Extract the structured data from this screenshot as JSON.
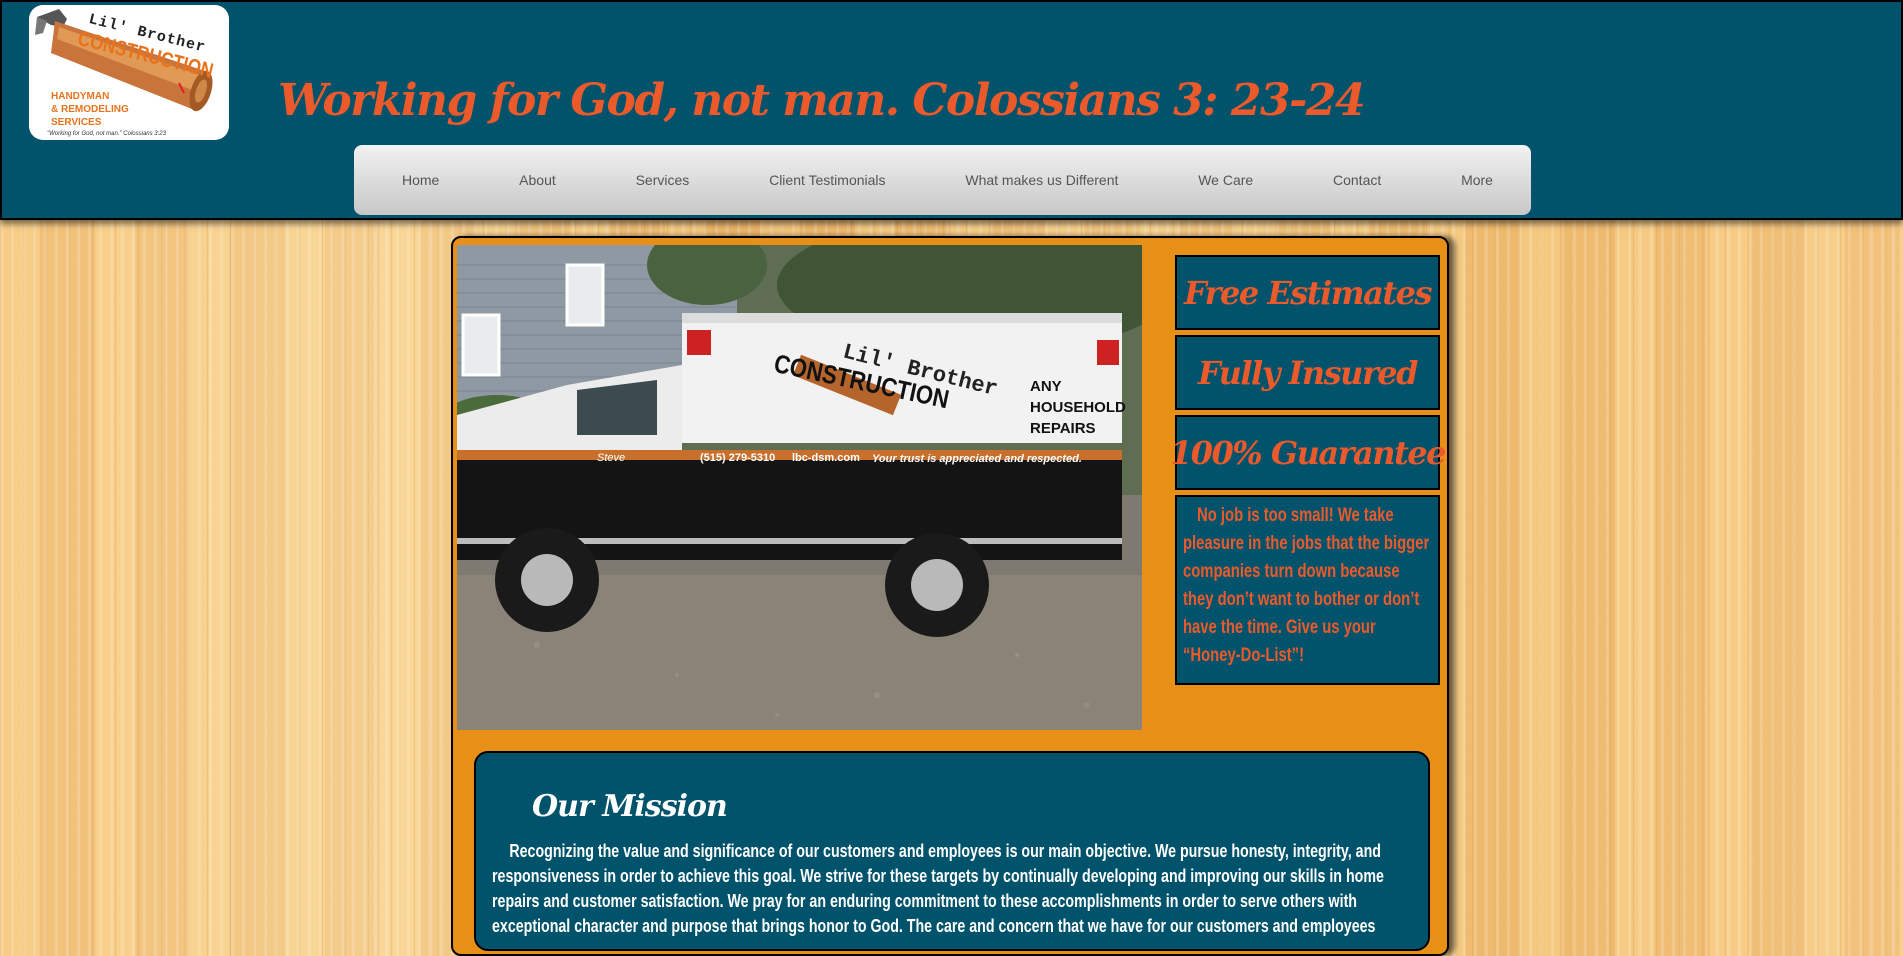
{
  "logo": {
    "line1": "Lil' Brother",
    "line2": "CONSTRUCTION",
    "services": [
      "HANDYMAN",
      "& REMODELING",
      "SERVICES"
    ],
    "tagline": "\"Working for God, not man.\" Colossians 3:23"
  },
  "header": {
    "headline": "Working for God, not man. Colossians 3: 23-24"
  },
  "nav": {
    "items": [
      "Home",
      "About",
      "Services",
      "Client Testimonials",
      "What makes us Different",
      "We Care",
      "Contact",
      "More"
    ]
  },
  "photo": {
    "truck": {
      "brand1": "Lil' Brother",
      "brand2": "CONSTRUCTION",
      "repairs": [
        "ANY",
        "HOUSEHOLD",
        "REPAIRS"
      ],
      "phone": "(515) 279-5310",
      "site": "lbc-dsm.com",
      "slogan": "Your trust is appreciated and respected.",
      "name": "Steve"
    }
  },
  "side": {
    "badges": [
      "Free Estimates",
      "Fully Insured",
      "100% Guarantee"
    ],
    "note": "No job is too small! We take pleasure in the jobs that the bigger companies turn down because they don’t want to bother or don’t have the time. Give us your “Honey-Do-List”!"
  },
  "mission": {
    "title": "Our Mission",
    "body": "Recognizing the value and significance of our customers and employees is our main objective. We pursue honesty, integrity, and responsiveness in order to achieve this goal. We strive for these targets by continually developing and improving our skills in home repairs and customer satisfaction. We pray for an enduring commitment to these accomplishments in order to serve others with exceptional character and purpose that brings honor to God. The care and concern that we have for our customers and employees"
  },
  "colors": {
    "header_bg": "#00536b",
    "accent_orange": "#ec5a2b",
    "panel_orange": "#e88f17"
  }
}
